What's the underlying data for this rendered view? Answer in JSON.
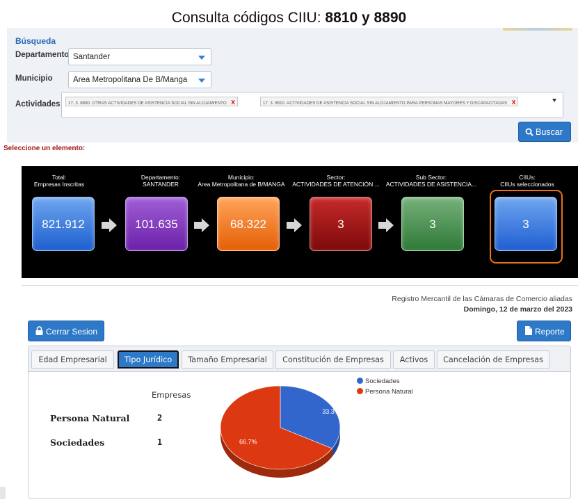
{
  "header": {
    "title_prefix": "Consulta códigos CIIU:",
    "title_codes": "8810 y 8890"
  },
  "search": {
    "section_title": "Búsqueda",
    "departamento_label": "Departamento",
    "departamento_value": "Santander",
    "municipio_label": "Municipio",
    "municipio_value": "Area Metropolitana De B/Manga",
    "actividades_label": "Actividades",
    "actividades": [
      "17. 3. 8890. OTRAS ACTIVIDADES DE ASISTENCIA SOCIAL SIN ALOJAMIENTO",
      "17. 3. 8810. ACTIVIDADES DE ASISTENCIA SOCIAL SIN ALOJAMIENTO PARA PERSONAS MAYORES Y DISCAPACITADAS"
    ],
    "remove_mark": "X",
    "buscar_label": "Buscar"
  },
  "seleccione": "Seleccione un elemento:",
  "funnel": [
    {
      "label1": "Total:",
      "label2": "Empresas Inscritas",
      "value": "821.912",
      "color": "#1d5fcf"
    },
    {
      "label1": "Departamento:",
      "label2": "SANTANDER",
      "value": "101.635",
      "color": "#6b21a8"
    },
    {
      "label1": "Municipio:",
      "label2": "Area Metropolitana de B/MANGA",
      "value": "68.322",
      "color": "#e45f06"
    },
    {
      "label1": "Sector:",
      "label2": "ACTIVIDADES DE ATENCIÓN ...",
      "value": "3",
      "color": "#7d0a0a"
    },
    {
      "label1": "Sub Sector:",
      "label2": "ACTIVIDADES DE ASISTENCIA...",
      "value": "3",
      "color": "#2f7a38"
    },
    {
      "label1": "CIIUs:",
      "label2": "CIIUs seleccionados",
      "value": "3",
      "color": "#1f5ed2"
    }
  ],
  "registro": "Registro Mercantil de las Cámaras de Comercio aliadas",
  "fecha": "Domingo, 12 de marzo del 2023",
  "buttons": {
    "cerrar": "Cerrar Sesion",
    "reporte": "Reporte"
  },
  "tabs": [
    {
      "label": "Edad Empresarial",
      "active": false
    },
    {
      "label": "Tipo Jurídico",
      "active": true
    },
    {
      "label": "Tamaño Empresarial",
      "active": false
    },
    {
      "label": "Constitución de Empresas",
      "active": false
    },
    {
      "label": "Activos",
      "active": false
    },
    {
      "label": "Cancelación de Empresas",
      "active": false
    }
  ],
  "table": {
    "header": "Empresas",
    "rows": [
      {
        "label": "Persona Natural",
        "value": "2"
      },
      {
        "label": "Sociedades",
        "value": "1"
      }
    ]
  },
  "chart_data": {
    "type": "pie",
    "categories": [
      "Sociedades",
      "Persona Natural"
    ],
    "values": [
      1,
      2
    ],
    "slice_labels": [
      "33.3%",
      "66.7%"
    ],
    "colors": [
      "#3366cc",
      "#dc3912"
    ],
    "legend_position": "top-right"
  }
}
